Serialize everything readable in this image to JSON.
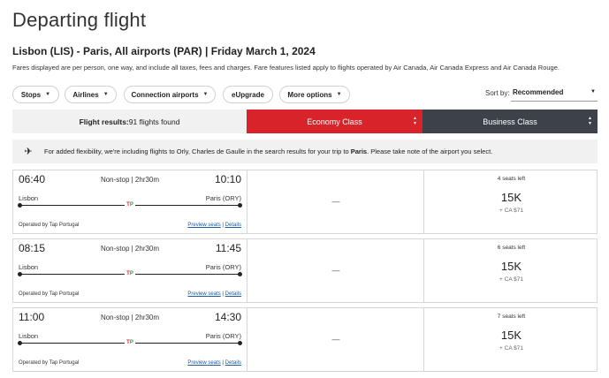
{
  "page_title": "Departing flight",
  "route_title": "Lisbon (LIS) - Paris, All airports (PAR)  |  Friday March 1, 2024",
  "fare_note": "Fares displayed are per person, one way, and include all taxes, fees and charges. Fare features listed apply to flights operated by Air Canada, Air Canada Express and Air Canada Rouge.",
  "filters": [
    "Stops",
    "Airlines",
    "Connection airports",
    "eUpgrade",
    "More options"
  ],
  "sort": {
    "label": "Sort by:",
    "value": "Recommended"
  },
  "tabs": {
    "results_label": "Flight results:",
    "results_count": "91 flights found",
    "economy": "Economy Class",
    "business": "Business Class"
  },
  "banner": {
    "text_before": "For added flexibility, we're including flights to Orly, Charles de Gaulle in the search results for your trip to ",
    "highlight": "Paris",
    "text_after": ". Please take note of the airport you select."
  },
  "flights": [
    {
      "dep_time": "06:40",
      "arr_time": "10:10",
      "duration": "Non-stop | 2hr30m",
      "origin": "Lisbon",
      "dest": "Paris (ORY)",
      "operated": "Operated by Tap Portugal",
      "preview": "Preview seats",
      "details": "Details",
      "economy": "—",
      "seats": "4 seats left",
      "points": "15K",
      "cash": "+ CA $71"
    },
    {
      "dep_time": "08:15",
      "arr_time": "11:45",
      "duration": "Non-stop | 2hr30m",
      "origin": "Lisbon",
      "dest": "Paris (ORY)",
      "operated": "Operated by Tap Portugal",
      "preview": "Preview seats",
      "details": "Details",
      "economy": "—",
      "seats": "6 seats left",
      "points": "15K",
      "cash": "+ CA $71"
    },
    {
      "dep_time": "11:00",
      "arr_time": "14:30",
      "duration": "Non-stop | 2hr30m",
      "origin": "Lisbon",
      "dest": "Paris (ORY)",
      "operated": "Operated by Tap Portugal",
      "preview": "Preview seats",
      "details": "Details",
      "economy": "—",
      "seats": "7 seats left",
      "points": "15K",
      "cash": "+ CA $71"
    }
  ],
  "icons": {
    "caret": "caret-down-icon",
    "plane": "airplane-icon",
    "airline_logo": "tap-logo-icon"
  },
  "colors": {
    "economy": "#d8232a",
    "business": "#3d4149",
    "link": "#1a5aa0"
  }
}
